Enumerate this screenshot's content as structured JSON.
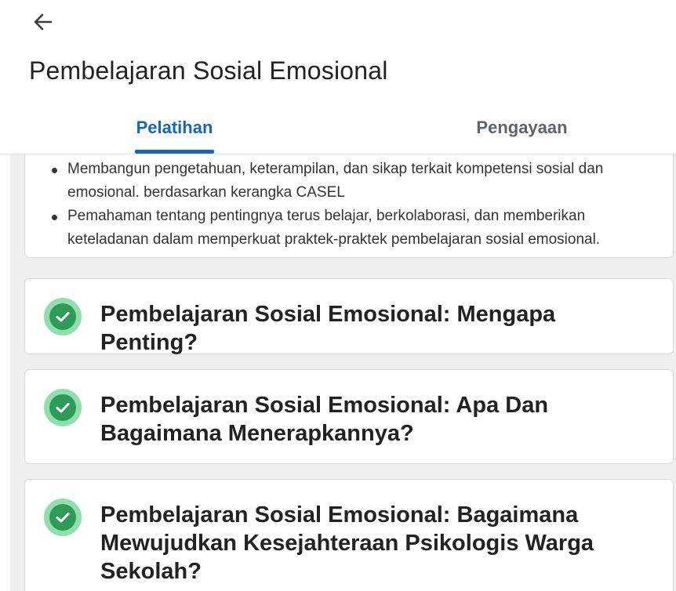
{
  "header": {
    "back_icon": "arrow-left-icon",
    "title": "Pembelajaran Sosial Emosional",
    "tabs": [
      {
        "label": "Pelatihan",
        "active": true
      },
      {
        "label": "Pengayaan",
        "active": false
      }
    ]
  },
  "description": {
    "bullets": [
      "Membangun pengetahuan, keterampilan, dan sikap terkait kompetensi sosial dan emosional. berdasarkan kerangka CASEL",
      "Pemahaman tentang pentingnya terus belajar, berkolaborasi, dan memberikan keteladanan dalam memperkuat praktek-praktek pembelajaran sosial emosional."
    ]
  },
  "modules": [
    {
      "title": "Pembelajaran Sosial Emosional: Mengapa Penting?",
      "status": "completed",
      "icon": "check-circle-icon"
    },
    {
      "title": "Pembelajaran Sosial Emosional: Apa Dan Bagaimana Menerapkannya?",
      "status": "completed",
      "icon": "check-circle-icon"
    },
    {
      "title": "Pembelajaran Sosial Emosional: Bagaimana Mewujudkan Kesejahteraan Psikologis Warga Sekolah?",
      "status": "completed",
      "icon": "check-circle-icon"
    }
  ],
  "colors": {
    "accent": "#1565c0",
    "inactive_tab": "#5f6368",
    "check_bg": "#8fdeab",
    "check_fg": "#2e9b59",
    "content_bg": "#efefef"
  }
}
